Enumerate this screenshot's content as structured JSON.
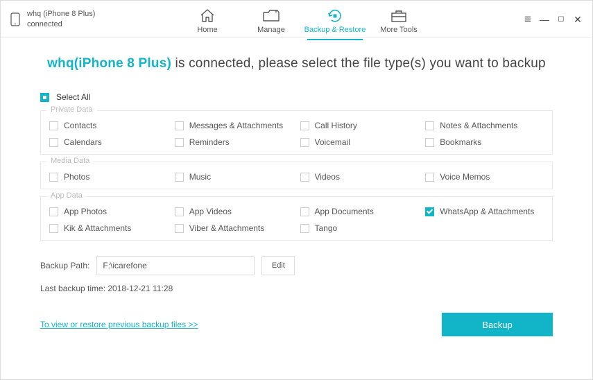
{
  "device": {
    "name": "whq (iPhone 8 Plus)",
    "status": "connected"
  },
  "nav": {
    "tabs": [
      {
        "label": "Home"
      },
      {
        "label": "Manage"
      },
      {
        "label": "Backup & Restore"
      },
      {
        "label": "More Tools"
      }
    ]
  },
  "window_controls": {
    "menu": "≡",
    "minimize": "—",
    "maximize": "◻",
    "close": "✕"
  },
  "headline": {
    "device": "whq(iPhone 8 Plus)",
    "rest": " is connected, please select the file type(s) you want to backup"
  },
  "select_all_label": "Select All",
  "groups": {
    "private": {
      "title": "Private Data",
      "items": [
        {
          "label": "Contacts",
          "checked": false
        },
        {
          "label": "Messages & Attachments",
          "checked": false
        },
        {
          "label": "Call History",
          "checked": false
        },
        {
          "label": "Notes & Attachments",
          "checked": false
        },
        {
          "label": "Calendars",
          "checked": false
        },
        {
          "label": "Reminders",
          "checked": false
        },
        {
          "label": "Voicemail",
          "checked": false
        },
        {
          "label": "Bookmarks",
          "checked": false
        }
      ]
    },
    "media": {
      "title": "Media Data",
      "items": [
        {
          "label": "Photos",
          "checked": false
        },
        {
          "label": "Music",
          "checked": false
        },
        {
          "label": "Videos",
          "checked": false
        },
        {
          "label": "Voice Memos",
          "checked": false
        }
      ]
    },
    "app": {
      "title": "App Data",
      "items": [
        {
          "label": "App Photos",
          "checked": false
        },
        {
          "label": "App Videos",
          "checked": false
        },
        {
          "label": "App Documents",
          "checked": false
        },
        {
          "label": "WhatsApp & Attachments",
          "checked": true
        },
        {
          "label": "Kik & Attachments",
          "checked": false
        },
        {
          "label": "Viber & Attachments",
          "checked": false
        },
        {
          "label": "Tango",
          "checked": false
        }
      ]
    }
  },
  "backup_path": {
    "label": "Backup Path:",
    "value": "F:\\icarefone",
    "edit_label": "Edit"
  },
  "last_backup": "Last backup time: 2018-12-21 11:28",
  "restore_link": "To view or restore previous backup files >>",
  "backup_button": "Backup",
  "colors": {
    "accent": "#12b5c7"
  }
}
